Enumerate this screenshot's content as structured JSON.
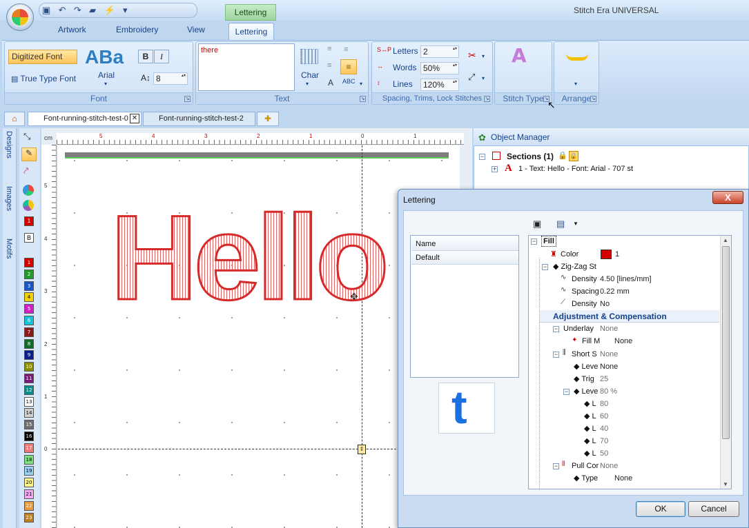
{
  "app": {
    "title": "Stitch Era UNIVERSAL",
    "context_tab": "Lettering"
  },
  "tabs": [
    "Artwork",
    "Embroidery",
    "View",
    "Lettering"
  ],
  "font_group": {
    "digitized": "Digitized Font",
    "truetype": "True Type Font",
    "preview": "ABa",
    "font": "Arial",
    "bold": "B",
    "italic": "I",
    "size": "8",
    "label": "Font"
  },
  "text_group": {
    "text": "there",
    "char": "Char",
    "label": "Text"
  },
  "spacing_group": {
    "letters_label": "Letters",
    "letters_value": "2",
    "words_label": "Words",
    "words_value": "50%",
    "lines_label": "Lines",
    "lines_value": "120%",
    "label": "Spacing, Trims, Lock Stitches"
  },
  "stitch_type": {
    "label": "Stitch Type"
  },
  "arrange": {
    "label": "Arrange"
  },
  "doc_tabs": [
    "Font-running-stitch-test-0",
    "Font-running-stitch-test-2"
  ],
  "side": {
    "designs": "Designs",
    "images": "Images",
    "motifs": "Motifs"
  },
  "colors": {
    "swatches": [
      {
        "n": "1",
        "c": "#d40000"
      },
      {
        "n": "2",
        "c": "#1e9b2b"
      },
      {
        "n": "3",
        "c": "#1a55c8"
      },
      {
        "n": "4",
        "c": "#f0d000"
      },
      {
        "n": "5",
        "c": "#d41fc6"
      },
      {
        "n": "6",
        "c": "#18c0d8"
      },
      {
        "n": "7",
        "c": "#8b1a1a"
      },
      {
        "n": "8",
        "c": "#0e6b2a"
      },
      {
        "n": "9",
        "c": "#0b1f8a"
      },
      {
        "n": "10",
        "c": "#8c8c00"
      },
      {
        "n": "11",
        "c": "#7a1a7a"
      },
      {
        "n": "12",
        "c": "#0c8a8a"
      },
      {
        "n": "13",
        "c": "#ffffff"
      },
      {
        "n": "14",
        "c": "#cfcfcf"
      },
      {
        "n": "15",
        "c": "#6e6e6e"
      },
      {
        "n": "16",
        "c": "#000000"
      },
      {
        "n": "17",
        "c": "#f07878"
      },
      {
        "n": "18",
        "c": "#7ee07e"
      },
      {
        "n": "19",
        "c": "#9ad0f0"
      },
      {
        "n": "20",
        "c": "#fff48a"
      },
      {
        "n": "21",
        "c": "#f4a6f0"
      },
      {
        "n": "22",
        "c": "#e69a3c"
      },
      {
        "n": "23",
        "c": "#c07f20"
      }
    ]
  },
  "ruler": {
    "unit": "cm",
    "h": [
      "5",
      "4",
      "3",
      "2",
      "1",
      "0",
      "1"
    ],
    "v": [
      "5",
      "4",
      "3",
      "2",
      "1",
      "0"
    ]
  },
  "canvas": {
    "word": "Hello"
  },
  "object_manager": {
    "title": "Object Manager",
    "sections": "Sections (1)",
    "item": "1 - Text: Hello - Font: Arial - 707 st"
  },
  "dialog": {
    "title": "Lettering",
    "close": "X",
    "names": {
      "header": "Name",
      "default": "Default"
    },
    "preview_char": "t",
    "fill": "Fill",
    "color_label": "Color",
    "color_value": "1",
    "zigzag": "Zig-Zag St",
    "density_label": "Density",
    "density_value": "4.50 [lines/mm]",
    "spacing_label": "Spacing",
    "spacing_value": "0.22 mm",
    "density2_label": "Density",
    "density2_value": "No",
    "adjust": "Adjustment & Compensation",
    "underlay_label": "Underlay",
    "underlay_value": "None",
    "fillm_label": "Fill M",
    "fillm_value": "None",
    "short_label": "Short S",
    "short_value": "None",
    "leve_label": "Leve",
    "leve_value": "None",
    "trig_label": "Trig",
    "trig_value": "25",
    "leve2_label": "Leve",
    "leve2_value": "80 %",
    "l_label": "L",
    "l_values": [
      "80",
      "60",
      "40",
      "70",
      "50"
    ],
    "pull_label": "Pull Cor",
    "pull_value": "None",
    "type_label": "Type",
    "type_value": "None",
    "ok": "OK",
    "cancel": "Cancel"
  },
  "accent": {
    "stitch": "#d42a2a",
    "ribbon": "#c8dcf4"
  }
}
